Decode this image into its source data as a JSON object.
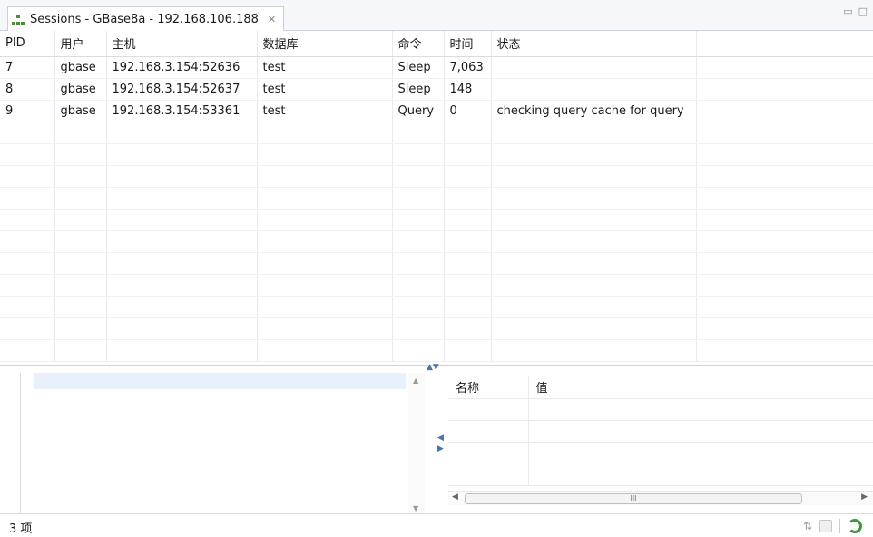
{
  "tab": {
    "title": "Sessions - GBase8a - 192.168.106.188",
    "close_icon": "close-icon"
  },
  "table": {
    "headers": [
      "PID",
      "用户",
      "主机",
      "数据库",
      "命令",
      "时间",
      "状态"
    ],
    "rows": [
      [
        "7",
        "gbase",
        "192.168.3.154:52636",
        "test",
        "Sleep",
        "7,063",
        ""
      ],
      [
        "8",
        "gbase",
        "192.168.3.154:52637",
        "test",
        "Sleep",
        "148",
        ""
      ],
      [
        "9",
        "gbase",
        "192.168.3.154:53361",
        "test",
        "Query",
        "0",
        "checking query cache for query"
      ]
    ]
  },
  "props": {
    "headers": [
      "名称",
      "值"
    ],
    "scroll_grip": "III"
  },
  "status": {
    "count": "3 项"
  }
}
